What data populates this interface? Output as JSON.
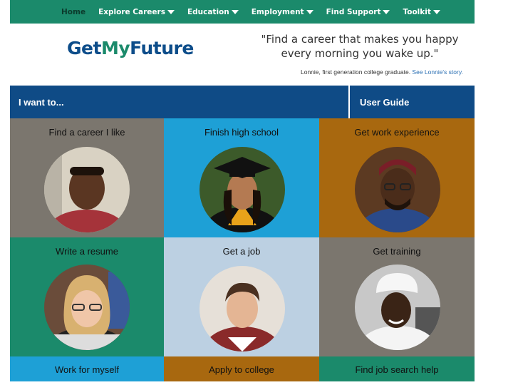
{
  "nav": {
    "items": [
      {
        "label": "Home",
        "dropdown": false
      },
      {
        "label": "Explore Careers",
        "dropdown": true
      },
      {
        "label": "Education",
        "dropdown": true
      },
      {
        "label": "Employment",
        "dropdown": true
      },
      {
        "label": "Find Support",
        "dropdown": true
      },
      {
        "label": "Toolkit",
        "dropdown": true
      }
    ]
  },
  "header": {
    "logo_part1": "Get",
    "logo_part2": "My",
    "logo_part3": "Future",
    "quote": "\"Find a career that makes you happy every morning you wake up.\"",
    "attribution_text": "Lonnie, first generation college graduate. ",
    "attribution_link": "See Lonnie's story."
  },
  "bar": {
    "left_label": "I want to...",
    "right_label": "User Guide"
  },
  "tiles": [
    {
      "label": "Find a career I like",
      "color": "#7b766e"
    },
    {
      "label": "Finish high school",
      "color": "#1ea0d6"
    },
    {
      "label": "Get work experience",
      "color": "#a8680f"
    },
    {
      "label": "Write a resume",
      "color": "#1b8a6b"
    },
    {
      "label": "Get a job",
      "color": "#bcd0e2"
    },
    {
      "label": "Get training",
      "color": "#7b766e"
    }
  ],
  "bottom_tiles": [
    {
      "label": "Work for myself",
      "color": "#1ea0d6"
    },
    {
      "label": "Apply to college",
      "color": "#a8680f"
    },
    {
      "label": "Find job search help",
      "color": "#1b8a6b"
    }
  ],
  "colors": {
    "nav_green": "#1b8a6b",
    "bar_blue": "#0f4b86",
    "logo_blue": "#0d4d8a"
  }
}
